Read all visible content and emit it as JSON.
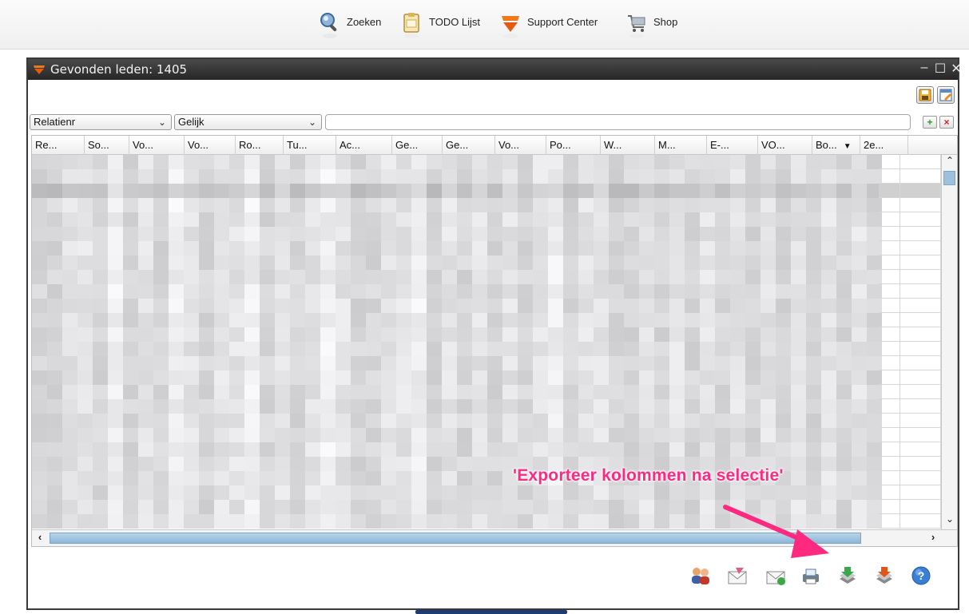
{
  "nav": {
    "items": [
      {
        "label": "Zoeken",
        "icon": "search-icon"
      },
      {
        "label": "TODO Lijst",
        "icon": "clipboard-icon"
      },
      {
        "label": "Support Center",
        "icon": "support-logo-icon"
      },
      {
        "label": "Shop",
        "icon": "shop-icon"
      }
    ]
  },
  "window": {
    "title": "Gevonden leden: 1405",
    "controls": {
      "minimize": "–",
      "maximize": "☐",
      "close": "✕"
    }
  },
  "filter": {
    "field": "Relatienr",
    "operator": "Gelijk",
    "value": "",
    "add_label": "+",
    "remove_label": "×"
  },
  "table": {
    "columns": [
      "Re...",
      "So...",
      "Vo...",
      "Vo...",
      "Ro...",
      "Tu...",
      "Ac...",
      "Ge...",
      "Ge...",
      "Vo...",
      "Po...",
      "W...",
      "M...",
      "E-...",
      "VO...",
      "Bo...",
      "2e..."
    ],
    "sorted_column_indicator": "▼"
  },
  "annotation": {
    "text": "'Exporteer kolommen na selectie'",
    "color": "#ff2a7f"
  },
  "colors": {
    "titlebar": "#2e2e2e",
    "scroll_thumb": "#9ec1db",
    "annotation": "#ff2a7f"
  }
}
